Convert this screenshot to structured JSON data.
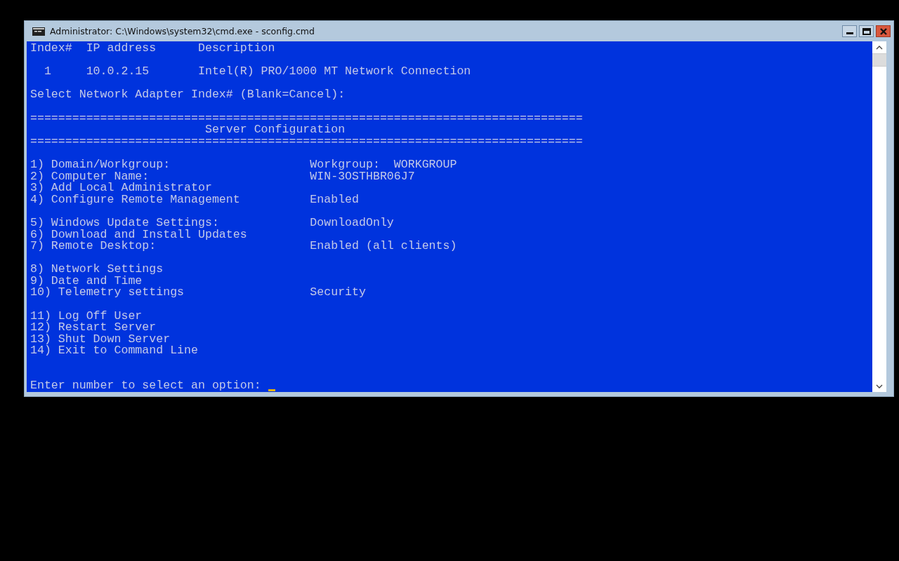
{
  "window": {
    "title": "Administrator: C:\\Windows\\system32\\cmd.exe - sconfig.cmd"
  },
  "adapter_table": {
    "columns": [
      "Index#",
      "IP address",
      "Description"
    ],
    "rows": [
      {
        "index": "1",
        "ip": "10.0.2.15",
        "description": "Intel(R) PRO/1000 MT Network Connection"
      }
    ]
  },
  "adapter_prompt": "Select Network Adapter Index# (Blank=Cancel):",
  "separator_top": "===============================================================================",
  "heading": "Server Configuration",
  "separator_bottom": "===============================================================================",
  "menu_groups": [
    [
      {
        "label": "1) Domain/Workgroup:",
        "value": "Workgroup:  WORKGROUP"
      },
      {
        "label": "2) Computer Name:",
        "value": "WIN-3OSTHBR06J7"
      },
      {
        "label": "3) Add Local Administrator"
      },
      {
        "label": "4) Configure Remote Management",
        "value": "Enabled"
      }
    ],
    [
      {
        "label": "5) Windows Update Settings:",
        "value": "DownloadOnly"
      },
      {
        "label": "6) Download and Install Updates"
      },
      {
        "label": "7) Remote Desktop:",
        "value": "Enabled (all clients)"
      }
    ],
    [
      {
        "label": "8) Network Settings"
      },
      {
        "label": "9) Date and Time"
      },
      {
        "label": "10) Telemetry settings",
        "value": "Security"
      }
    ],
    [
      {
        "label": "11) Log Off User"
      },
      {
        "label": "12) Restart Server"
      },
      {
        "label": "13) Shut Down Server"
      },
      {
        "label": "14) Exit to Command Line"
      }
    ]
  ],
  "prompt": "Enter number to select an option:"
}
